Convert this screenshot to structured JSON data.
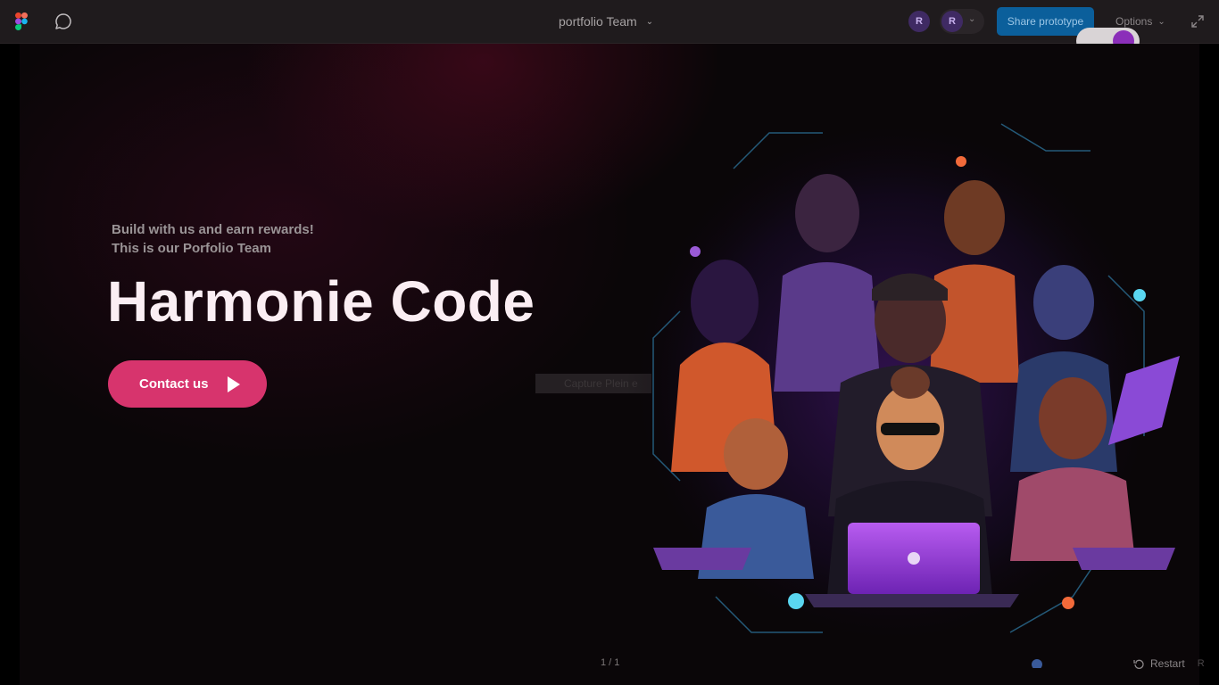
{
  "toolbar": {
    "file_title": "portfolio Team",
    "avatars": [
      "R",
      "R"
    ],
    "share_label": "Share prototype",
    "options_label": "Options"
  },
  "hero": {
    "tagline_line1": "Build with us and earn rewards!",
    "tagline_line2": "This is our Porfolio Team",
    "title": "Harmonie Code",
    "contact_label": "Contact us"
  },
  "overlay": {
    "capture_text": "Capture Plein e"
  },
  "footer": {
    "page_count": "1 / 1",
    "restart_label": "Restart",
    "restart_shortcut": "R"
  },
  "colors": {
    "accent_pink": "#d7346d",
    "share_blue": "#0b5f9b",
    "toggle_purple": "#8b2fb9",
    "title": "#fbeef3"
  },
  "icons": [
    "figma-logo-icon",
    "comment-icon",
    "chevron-down-icon",
    "expand-icon",
    "play-icon",
    "restart-icon"
  ]
}
